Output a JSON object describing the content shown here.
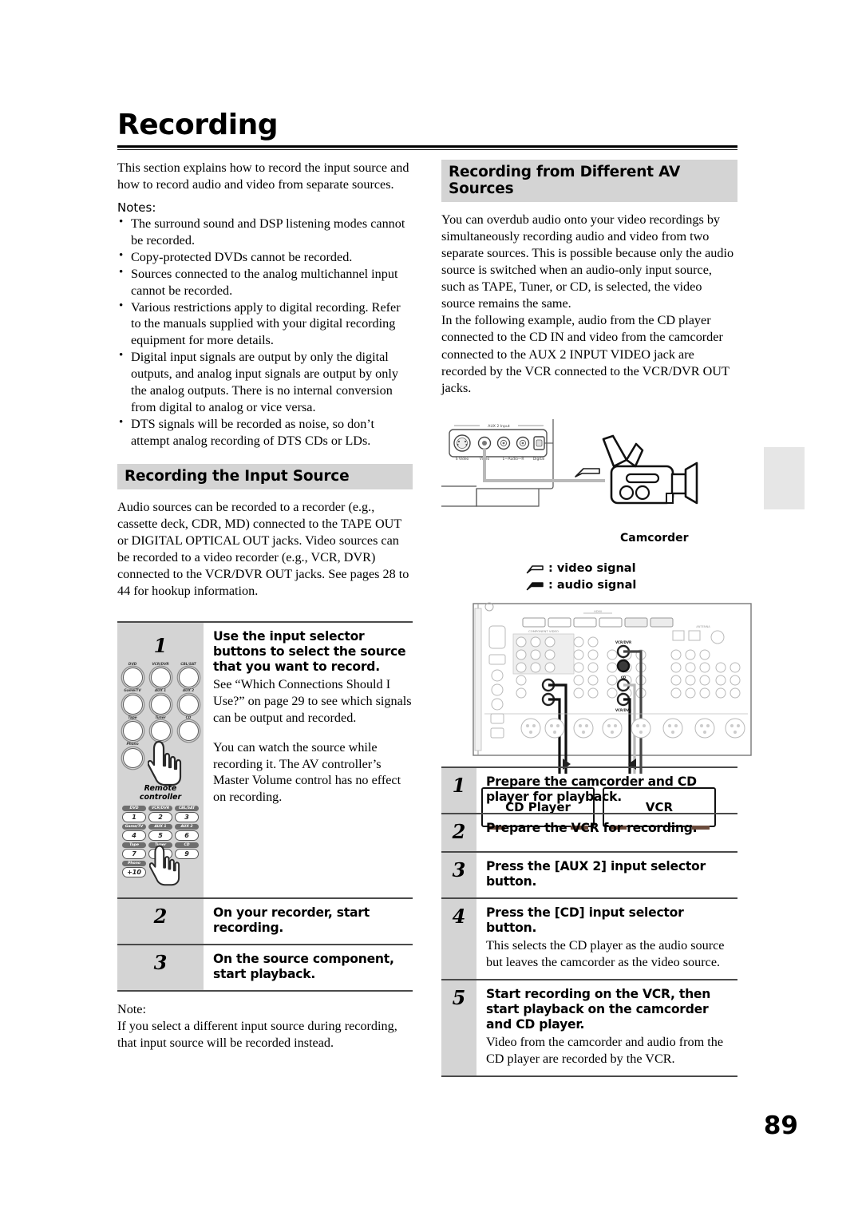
{
  "page": {
    "title": "Recording",
    "number": "89"
  },
  "intro": {
    "paragraph": "This section explains how to record the input source and how to record audio and video from separate sources.",
    "notes_label": "Notes:",
    "notes": [
      "The surround sound and DSP listening modes cannot be recorded.",
      "Copy-protected DVDs cannot be recorded.",
      "Sources connected to the analog multichannel input cannot be recorded.",
      "Various restrictions apply to digital recording. Refer to the manuals supplied with your digital recording equipment for more details.",
      "Digital input signals are output by only the digital outputs, and analog input signals are output by only the analog outputs. There is no internal conversion from digital to analog or vice versa.",
      "DTS signals will be recorded as noise, so don’t attempt analog recording of DTS CDs or LDs."
    ]
  },
  "section_input_source": {
    "heading": "Recording the Input Source",
    "paragraph": "Audio sources can be recorded to a recorder (e.g., cassette deck, CDR, MD) connected to the TAPE OUT or DIGITAL OPTICAL OUT jacks. Video sources can be recorded to a video recorder (e.g., VCR, DVR) connected to the VCR/DVR OUT jacks. See pages 28 to 44 for hookup information.",
    "steps": [
      {
        "number": "1",
        "head": "Use the input selector buttons to select the source that you want to record.",
        "body1": "See “Which Connections Should I Use?” on page 29 to see which signals can be output and recorded.",
        "body2": "You can watch the source while recording it. The AV controller’s Master Volume control has no effect on recording."
      },
      {
        "number": "2",
        "head": "On your recorder, start recording.",
        "body1": "",
        "body2": ""
      },
      {
        "number": "3",
        "head": "On the source component, start playback.",
        "body1": "",
        "body2": ""
      }
    ],
    "note_label": "Note:",
    "note_text": "If you select a different input source during recording, that input source will be recorded instead."
  },
  "remote": {
    "caption_line1": "Remote",
    "caption_line2": "controller",
    "selector_buttons": [
      [
        "DVD",
        "VCR/DVR",
        "CBL/SAT"
      ],
      [
        "Game/TV",
        "AUX 1",
        "AUX 2"
      ],
      [
        "Tape",
        "Tuner",
        "CD"
      ],
      [
        "Phono"
      ]
    ],
    "keypad": [
      [
        {
          "cap": "DVD",
          "key": "1"
        },
        {
          "cap": "VCR/DVR",
          "key": "2"
        },
        {
          "cap": "CBL/SAT",
          "key": "3"
        }
      ],
      [
        {
          "cap": "Game/TV",
          "key": "4"
        },
        {
          "cap": "AUX 1",
          "key": "5"
        },
        {
          "cap": "AUX 2",
          "key": "6"
        }
      ],
      [
        {
          "cap": "Tape",
          "key": "7"
        },
        {
          "cap": "Tuner",
          "key": "8"
        },
        {
          "cap": "CD",
          "key": "9"
        }
      ],
      [
        {
          "cap": "Phono",
          "key": "+10"
        }
      ]
    ]
  },
  "section_av_sources": {
    "heading": "Recording from Different AV Sources",
    "paragraph1": "You can overdub audio onto your video recordings by simultaneously recording audio and video from two separate sources. This is possible because only the audio source is switched when an audio-only input source, such as TAPE, Tuner, or CD, is selected, the video source remains the same.",
    "paragraph2": "In the following example, audio from the CD player connected to the CD IN and video from the camcorder connected to the AUX 2 INPUT VIDEO jack are recorded by the VCR connected to the VCR/DVR OUT jacks.",
    "steps": [
      {
        "number": "1",
        "head": "Prepare the camcorder and CD player for playback.",
        "body": ""
      },
      {
        "number": "2",
        "head": "Prepare the VCR for recording.",
        "body": ""
      },
      {
        "number": "3",
        "head": "Press the [AUX 2] input selector button.",
        "body": ""
      },
      {
        "number": "4",
        "head": "Press the [CD] input selector button.",
        "body": "This selects the CD player as the audio source but leaves the camcorder as the video source."
      },
      {
        "number": "5",
        "head": "Start recording on the VCR, then start playback on the camcorder and CD player.",
        "body": "Video from the camcorder and audio from the CD player are recorded by the VCR."
      }
    ]
  },
  "diagram": {
    "aux_panel_title": "AUX 2 Input",
    "aux_jack_labels": [
      "S Video",
      "Video",
      "L—Audio—R",
      "Digital"
    ],
    "camcorder_label": "Camcorder",
    "legend": [
      {
        "symbol": "video-signal-arrow",
        "text": ": video signal"
      },
      {
        "symbol": "audio-signal-arrow",
        "text": ": audio signal"
      }
    ],
    "devices": [
      {
        "label": "CD Player"
      },
      {
        "label": "VCR"
      }
    ],
    "rear_panel_jack_labels": [
      "VCR/DVR",
      "CD",
      "VCR/DVR"
    ]
  },
  "colors": {
    "heading_bar": "#d4d4d4",
    "rule": "#4a4a4a",
    "edge_tab": "#e6e6e6"
  }
}
